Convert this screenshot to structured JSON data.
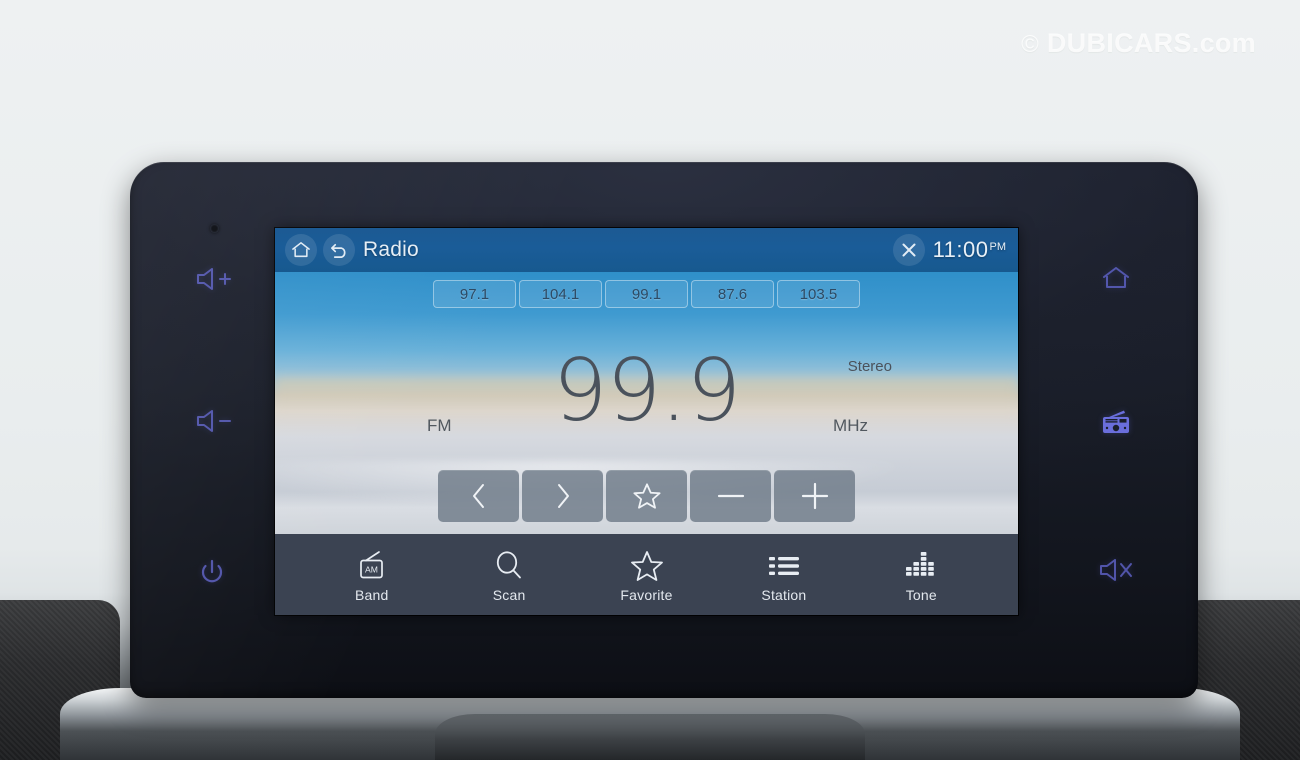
{
  "watermark": {
    "text": "© DUBICARS.com",
    "symbol": "©",
    "name": "DUBICARS.com"
  },
  "screen": {
    "titlebar": {
      "home_icon": "home-icon",
      "back_icon": "back-arrow-icon",
      "title": "Radio",
      "close_icon": "close-x-icon",
      "clock": "11:00",
      "clock_meridiem": "PM"
    },
    "presets": [
      {
        "label": "97.1"
      },
      {
        "label": "104.1"
      },
      {
        "label": "99.1"
      },
      {
        "label": "87.6"
      },
      {
        "label": "103.5"
      }
    ],
    "tuner": {
      "frequency": "99.9",
      "band": "FM",
      "unit": "MHz",
      "stereo": "Stereo"
    },
    "controls": [
      {
        "name": "previous-station-button",
        "icon": "chevron-left-icon",
        "glyph": "‹"
      },
      {
        "name": "next-station-button",
        "icon": "chevron-right-icon",
        "glyph": "›"
      },
      {
        "name": "favorite-button",
        "icon": "star-icon",
        "glyph": "☆"
      },
      {
        "name": "tune-down-button",
        "icon": "minus-icon",
        "glyph": "−"
      },
      {
        "name": "tune-up-button",
        "icon": "plus-icon",
        "glyph": "+"
      }
    ],
    "navbar": [
      {
        "label": "Band",
        "icon": "am-radio-icon",
        "badge": "AM"
      },
      {
        "label": "Scan",
        "icon": "search-icon"
      },
      {
        "label": "Favorite",
        "icon": "star-icon"
      },
      {
        "label": "Station",
        "icon": "list-icon"
      },
      {
        "label": "Tone",
        "icon": "equalizer-icon"
      }
    ]
  },
  "hardkeys": {
    "left": [
      {
        "name": "volume-up-key",
        "icon": "speaker-plus-icon"
      },
      {
        "name": "volume-down-key",
        "icon": "speaker-minus-icon"
      },
      {
        "name": "power-key",
        "icon": "power-icon"
      }
    ],
    "right": [
      {
        "name": "home-key",
        "icon": "home-icon"
      },
      {
        "name": "radio-key",
        "icon": "radio-icon"
      },
      {
        "name": "mute-key",
        "icon": "speaker-mute-icon"
      }
    ]
  },
  "colors": {
    "titlebar_blue": "#1a5c98",
    "navbar_slate": "#3b4352",
    "hardkey_purple": "#5f63c9",
    "frequency_gray": "#4a525c",
    "control_button": "#6c7886"
  }
}
